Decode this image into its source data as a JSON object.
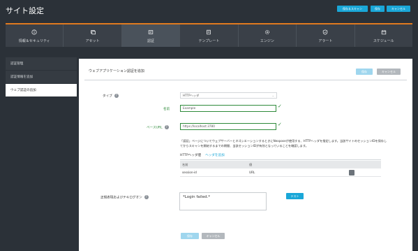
{
  "header": {
    "title": "サイト設定",
    "buttons": [
      {
        "label": "保存＆スキャン"
      },
      {
        "label": "保存"
      },
      {
        "label": "キャンセル"
      }
    ]
  },
  "tabs": [
    {
      "label": "情報＆セキュリティ",
      "icon": "info-icon"
    },
    {
      "label": "アセット",
      "icon": "asset-icon"
    },
    {
      "label": "認証",
      "icon": "auth-icon",
      "active": true
    },
    {
      "label": "テンプレート",
      "icon": "template-icon"
    },
    {
      "label": "エンジン",
      "icon": "engine-icon"
    },
    {
      "label": "アラート",
      "icon": "alert-icon"
    },
    {
      "label": "スケジュール",
      "icon": "schedule-icon"
    }
  ],
  "sidebar": {
    "items": [
      {
        "label": "認証管理"
      },
      {
        "label": "認証情報を追加"
      },
      {
        "label": "ウェブ認証の追加",
        "active": true
      }
    ]
  },
  "panel": {
    "title": "ウェブアプリケーション認証を追加",
    "save_label": "保存",
    "cancel_label": "キャンセル",
    "type_label": "タイプ",
    "type_value": "HTTPヘッダ",
    "name_label": "名前",
    "name_value": "Example",
    "base_url_label": "ベースURL",
    "base_url_value": "https://localhost:3780",
    "info_text": "「認証」ページについてウェブサーバーとネゴシエーションするときにNexposeが使用する、HTTPヘッダを指定します。当該サイトのセッションIDを保存してからスキャンを開始するまでの期間、当該セッションIDが有効となっていることを確認します。",
    "headers_tab": "HTTPヘッダ値",
    "add_header": "ヘッダを追加",
    "table_headers": [
      "名前",
      "値"
    ],
    "table_rows": [
      {
        "name": "session-id",
        "value": "URL"
      }
    ],
    "regex_label": "正規表現およびテキログオン",
    "regex_value": "*Login failed.*",
    "test_label": "テスト",
    "bottom_save": "保存",
    "bottom_cancel": "キャンセル"
  },
  "colors": {
    "accent": "#1aa7d8",
    "valid": "#2e8a3a",
    "tab_highlight": "#e07a1f"
  }
}
